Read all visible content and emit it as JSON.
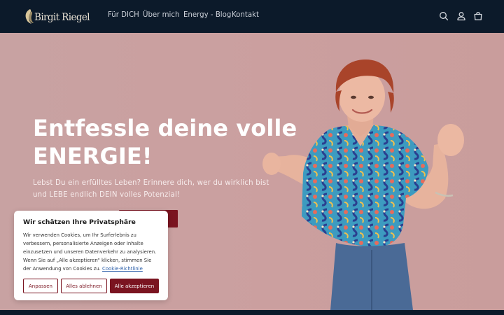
{
  "brand": {
    "logo_text": "Birgit Riegel",
    "navy": "#0c1a2a",
    "accent": "#7a1420",
    "hero_bg": "#c9a0a0"
  },
  "nav": {
    "items": [
      {
        "label": "Für DICH"
      },
      {
        "label": "Über mich"
      },
      {
        "label": "Energy - Blog"
      },
      {
        "label": "Kontakt"
      }
    ],
    "icons": [
      "search-icon",
      "account-icon",
      "cart-icon"
    ]
  },
  "hero": {
    "headline_line1": "Entfessle deine volle",
    "headline_line2": "ENERGIE!",
    "sub_line1": "Lebst Du ein erfülltes Leben? Erinnere dich, wer du wirklich bist",
    "sub_line2": "und LEBE endlich DEIN volles Potenzial!"
  },
  "cookie": {
    "title": "Wir schätzen Ihre Privatsphäre",
    "body_lines": [
      "Wir verwenden Cookies, um Ihr Surferlebnis zu",
      "verbessern, personalisierte Anzeigen oder Inhalte",
      "einzusetzen und unseren Datenverkehr zu analysieren.",
      "Wenn Sie auf „Alle akzeptieren“ klicken, stimmen Sie",
      "der Anwendung von Cookies zu."
    ],
    "policy_link": "Cookie-Richtlinie",
    "btn_customize": "Anpassen",
    "btn_reject": "Alles ablehnen",
    "btn_accept": "Alle akzeptieren"
  }
}
